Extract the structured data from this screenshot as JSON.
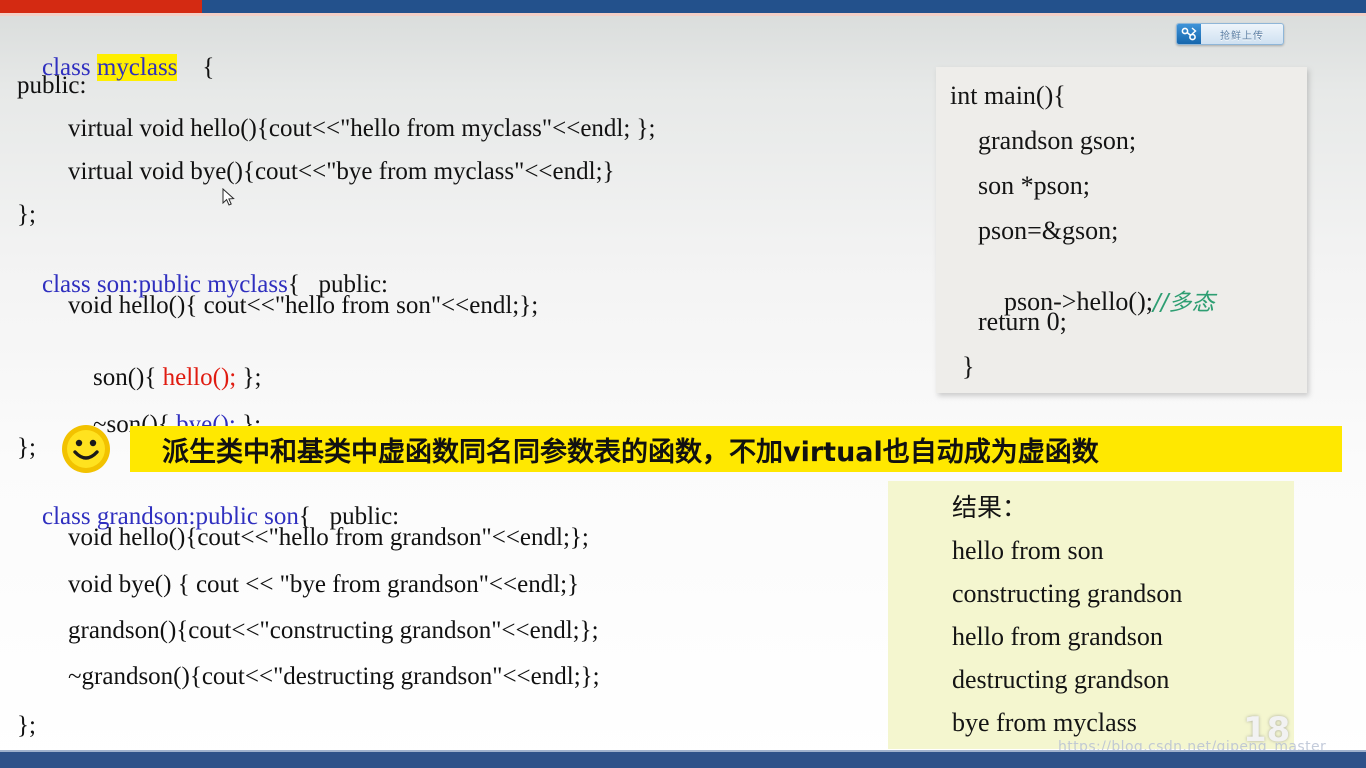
{
  "topbar": {
    "red_color": "#d42a12",
    "blue_color": "#23518c"
  },
  "badge": {
    "icon": "upload-badge-icon",
    "label": "抢鲜上传"
  },
  "code_left": {
    "lines": [
      {
        "id": "l1a",
        "text": "class ",
        "style": "kw-blue"
      },
      {
        "id": "l1b",
        "text": "myclass",
        "style": "hl-yellow"
      },
      {
        "id": "l1c",
        "text": "{",
        "style": "plain"
      },
      {
        "id": "l2",
        "text": "public:",
        "style": "plain"
      },
      {
        "id": "l3",
        "text": "virtual void hello(){cout<<\"hello from myclass\"<<endl; };",
        "style": "plain"
      },
      {
        "id": "l4",
        "text": "virtual void bye(){cout<<\"bye from myclass\"<<endl;}",
        "style": "plain"
      },
      {
        "id": "l5",
        "text": "};",
        "style": "plain"
      },
      {
        "id": "l6a",
        "text": "class son:public myclass",
        "style": "kw-blue"
      },
      {
        "id": "l6b",
        "text": "{   public:",
        "style": "plain"
      },
      {
        "id": "l7",
        "text": "void hello(){ cout<<\"hello from son\"<<endl;};",
        "style": "plain"
      },
      {
        "id": "l8a",
        "text": "son(){ ",
        "style": "plain"
      },
      {
        "id": "l8b",
        "text": "hello();",
        "style": "kw-red"
      },
      {
        "id": "l8c",
        "text": " };",
        "style": "plain"
      },
      {
        "id": "l9a",
        "text": "~son(){ ",
        "style": "plain"
      },
      {
        "id": "l9b",
        "text": "bye();",
        "style": "kw-blue"
      },
      {
        "id": "l9c",
        "text": " };",
        "style": "plain"
      },
      {
        "id": "l10",
        "text": "};",
        "style": "plain"
      },
      {
        "id": "l11a",
        "text": "class grandson:public son",
        "style": "kw-blue"
      },
      {
        "id": "l11b",
        "text": "{   public:",
        "style": "plain"
      },
      {
        "id": "l12",
        "text": "void hello(){cout<<\"hello from grandson\"<<endl;};",
        "style": "plain"
      },
      {
        "id": "l13",
        "text": "void bye() { cout << \"bye from grandson\"<<endl;}",
        "style": "plain"
      },
      {
        "id": "l14",
        "text": "grandson(){cout<<\"constructing grandson\"<<endl;};",
        "style": "plain"
      },
      {
        "id": "l15",
        "text": "~grandson(){cout<<\"destructing grandson\"<<endl;};",
        "style": "plain"
      },
      {
        "id": "l16",
        "text": "};",
        "style": "plain"
      }
    ]
  },
  "banner": {
    "icon": "smiley-face-icon",
    "text": "派生类中和基类中虚函数同名同参数表的函数，不加virtual也自动成为虚函数",
    "background": "#ffe800"
  },
  "main_panel": {
    "background": "#eeedea",
    "lines": [
      {
        "id": "m1",
        "text": "int main(){",
        "style": "plain"
      },
      {
        "id": "m2",
        "text": "grandson gson;",
        "style": "c-red"
      },
      {
        "id": "m3",
        "text": "son *pson;",
        "style": "plain"
      },
      {
        "id": "m4",
        "text": "pson=&gson;",
        "style": "plain"
      },
      {
        "id": "m5a",
        "text": "pson->hello();",
        "style": "plain"
      },
      {
        "id": "m5b",
        "text": "//多态",
        "style": "c-green"
      },
      {
        "id": "m6",
        "text": "return 0;",
        "style": "plain"
      },
      {
        "id": "m7",
        "text": "}",
        "style": "plain"
      }
    ]
  },
  "result_panel": {
    "background": "#f4f6cf",
    "title": "结果：",
    "lines": [
      "hello from son",
      "constructing grandson",
      "hello from grandson",
      "destructing grandson",
      "bye from myclass"
    ]
  },
  "page_number": "18",
  "watermark": "https://blog.csdn.net/qipeng_master"
}
